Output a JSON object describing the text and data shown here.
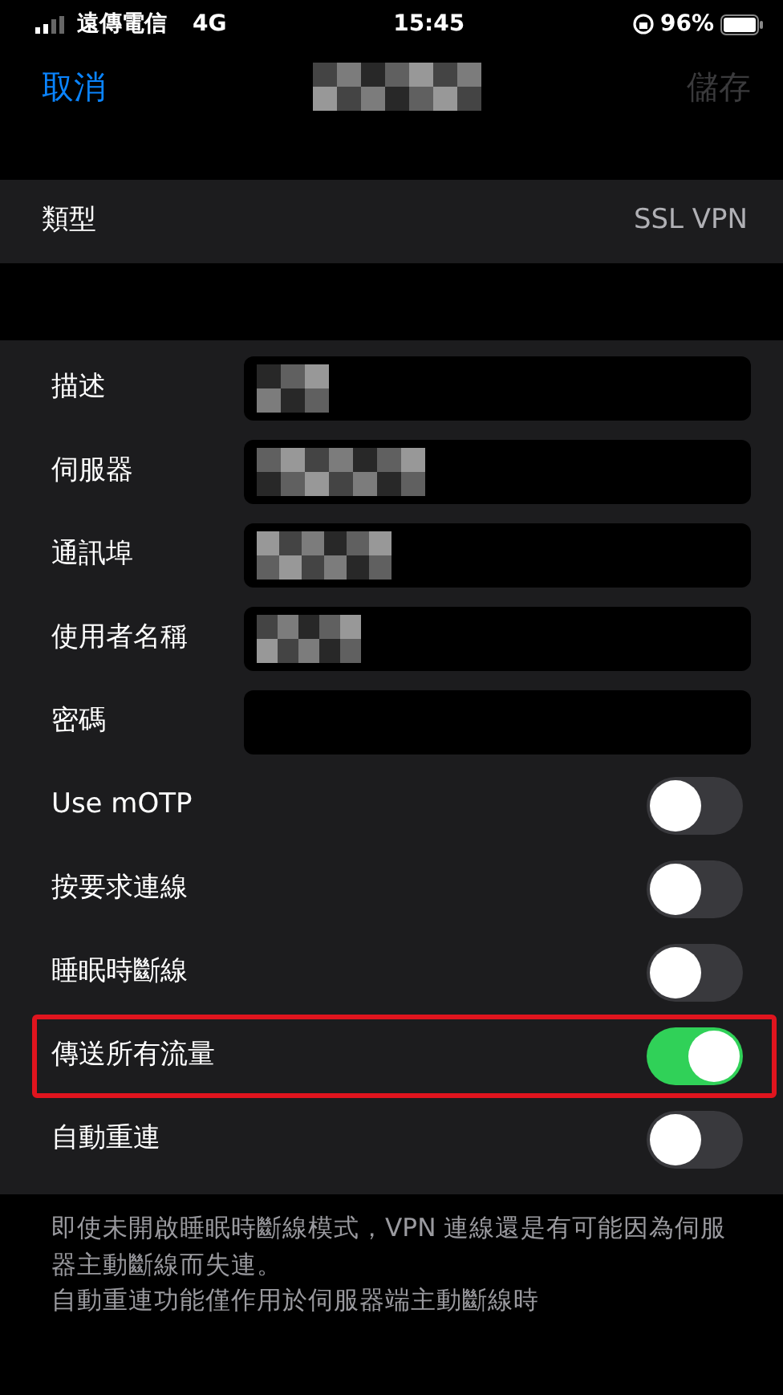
{
  "status_bar": {
    "carrier": "遠傳電信",
    "network": "4G",
    "time": "15:45",
    "battery": "96%"
  },
  "nav": {
    "cancel": "取消",
    "title_redacted": true,
    "save": {
      "label": "儲存",
      "disabled": true
    }
  },
  "type_row": {
    "label": "類型",
    "value": "SSL VPN"
  },
  "fields": [
    {
      "label": "描述",
      "redacted": true
    },
    {
      "label": "伺服器",
      "redacted": true
    },
    {
      "label": "通訊埠",
      "redacted": true
    },
    {
      "label": "使用者名稱",
      "redacted": true
    },
    {
      "label": "密碼",
      "redacted": false
    }
  ],
  "switches": [
    {
      "label": "Use mOTP",
      "on": false,
      "highlighted": false
    },
    {
      "label": "按要求連線",
      "on": false,
      "highlighted": false
    },
    {
      "label": "睡眠時斷線",
      "on": false,
      "highlighted": false
    },
    {
      "label": "傳送所有流量",
      "on": true,
      "highlighted": true
    },
    {
      "label": "自動重連",
      "on": false,
      "highlighted": false
    }
  ],
  "footer": [
    "即使未開啟睡眠時斷線模式，VPN 連線還是有可能因為伺服器主動斷線而失連。",
    "自動重連功能僅作用於伺服器端主動斷線時"
  ]
}
